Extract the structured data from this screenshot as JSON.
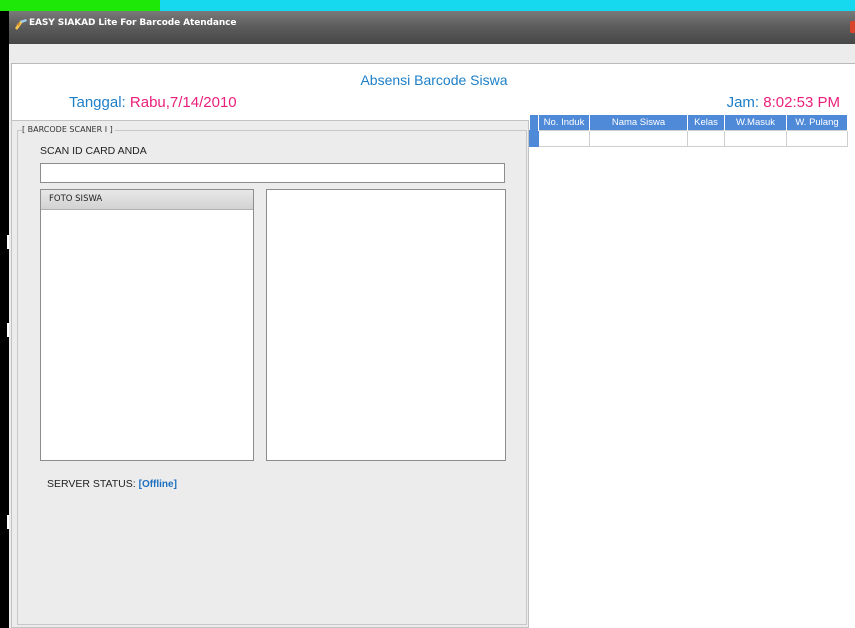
{
  "window": {
    "title": "EASY SIAKAD Lite For Barcode Atendance"
  },
  "header": {
    "title": "Absensi Barcode Siswa",
    "tanggal_label": "Tanggal:",
    "tanggal_value": "Rabu,7/14/2010",
    "jam_label": "Jam:",
    "jam_value": "8:02:53 PM"
  },
  "scanner": {
    "group_label": "[ BARCODE SCANER I ]",
    "scan_label": "SCAN ID CARD ANDA",
    "scan_value": "",
    "foto_header": "FOTO SISWA",
    "status_label": "SERVER STATUS:",
    "status_value": "[Offline]"
  },
  "table": {
    "columns": [
      "No. Induk",
      "Nama Siswa",
      "Kelas",
      "W.Masuk",
      "W. Pulang"
    ],
    "rows": [
      [
        "",
        "",
        "",
        "",
        ""
      ]
    ]
  },
  "colors": {
    "accent_blue": "#1d7fc8",
    "value_pink": "#ea1f7c",
    "grid_header": "#4f8ad9"
  }
}
